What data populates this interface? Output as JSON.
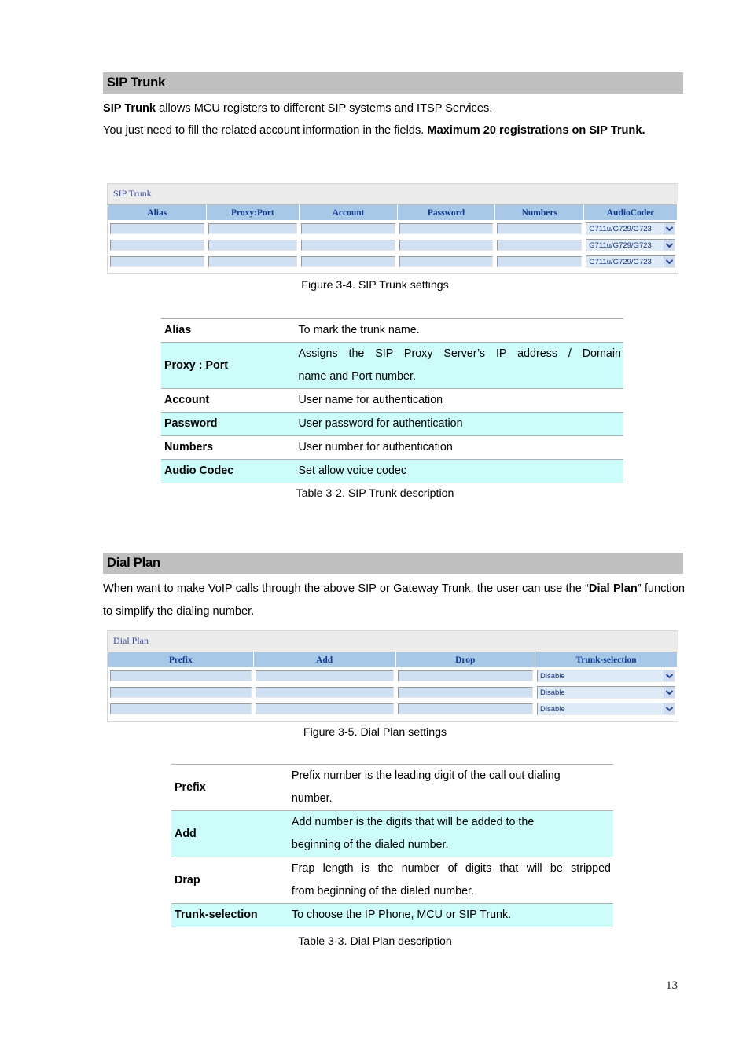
{
  "document": {
    "page_number": "13"
  },
  "sip_trunk": {
    "heading": "SIP Trunk",
    "para1_bold": "SIP Trunk",
    "para1_rest": " allows MCU registers to different SIP systems and ITSP Services.",
    "para2_rest": "You just need to fill the related account information in the fields. ",
    "para2_bold": "Maximum 20 registrations on SIP Trunk.",
    "figure": {
      "panel_title": "SIP Trunk",
      "columns": [
        "Alias",
        "Proxy:Port",
        "Account",
        "Password",
        "Numbers",
        "AudioCodec"
      ],
      "rows": [
        {
          "alias": "",
          "proxy_port": "",
          "account": "",
          "password": "",
          "numbers": "",
          "audio_codec": "G711u/G729/G723"
        },
        {
          "alias": "",
          "proxy_port": "",
          "account": "",
          "password": "",
          "numbers": "",
          "audio_codec": "G711u/G729/G723"
        },
        {
          "alias": "",
          "proxy_port": "",
          "account": "",
          "password": "",
          "numbers": "",
          "audio_codec": "G711u/G729/G723"
        }
      ],
      "caption": "Figure 3-4. SIP Trunk settings"
    },
    "description": {
      "rows": [
        {
          "term": "Alias",
          "lines": [
            "To mark the trunk name."
          ]
        },
        {
          "term": "Proxy : Port",
          "lines": [
            "Assigns the SIP Proxy Server’s IP address / Domain",
            "name and Port number."
          ]
        },
        {
          "term": "Account",
          "lines": [
            "User name for authentication"
          ]
        },
        {
          "term": "Password",
          "lines": [
            "User password for authentication"
          ]
        },
        {
          "term": "Numbers",
          "lines": [
            "User number for authentication"
          ]
        },
        {
          "term": "Audio Codec",
          "lines": [
            "Set allow voice codec"
          ]
        }
      ],
      "caption": "Table 3-2. SIP Trunk description"
    }
  },
  "dial_plan": {
    "heading": "Dial Plan",
    "para1_a": "When want to make VoIP calls through the above SIP or Gateway Trunk, the user can use the “",
    "para1_b": "Dial Plan",
    "para1_c": "” function to simplify the dialing number.",
    "figure": {
      "panel_title": "Dial Plan",
      "columns": [
        "Prefix",
        "Add",
        "Drop",
        "Trunk-selection"
      ],
      "rows": [
        {
          "prefix": "",
          "add": "",
          "drop": "",
          "trunk_selection": "Disable"
        },
        {
          "prefix": "",
          "add": "",
          "drop": "",
          "trunk_selection": "Disable"
        },
        {
          "prefix": "",
          "add": "",
          "drop": "",
          "trunk_selection": "Disable"
        }
      ],
      "caption": "Figure 3-5. Dial Plan settings"
    },
    "description": {
      "rows": [
        {
          "term": "Prefix",
          "lines": [
            "Prefix number is the leading digit of the call out dialing",
            "number."
          ]
        },
        {
          "term": "Add",
          "lines": [
            "Add number is the digits that will be added to the",
            "beginning of the dialed number."
          ]
        },
        {
          "term": "Drap",
          "lines": [
            "Frap length is the number of digits that will be stripped",
            "from beginning of the dialed number."
          ]
        },
        {
          "term": "Trunk-selection",
          "lines": [
            "To choose the IP Phone, MCU or SIP Trunk."
          ]
        }
      ],
      "caption": "Table 3-3. Dial Plan description"
    }
  },
  "colors": {
    "section_bar": "#c0c0c0",
    "table_header": "#a8c8e8",
    "table_header_text": "#123a8f",
    "alt_row": "#ccfdfb",
    "panel_title_text": "#3a4fa0"
  }
}
